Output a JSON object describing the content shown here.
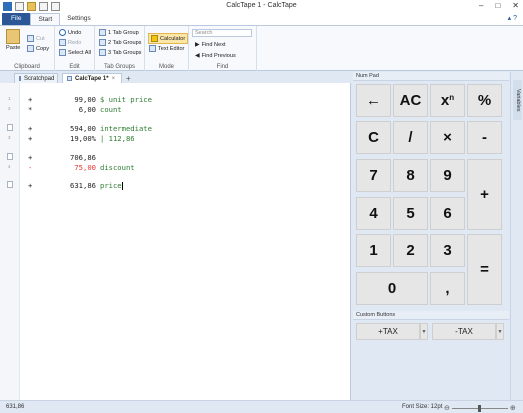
{
  "window": {
    "title": "CalcTape 1 - CalcTape"
  },
  "ribbon": {
    "tabs": [
      "File",
      "Start",
      "Settings"
    ],
    "groups": {
      "clipboard": {
        "label": "Clipboard",
        "paste": "Paste",
        "cut": "Cut",
        "copy": "Copy"
      },
      "edit": {
        "label": "Edit",
        "undo": "Undo",
        "redo": "Redo",
        "select_all": "Select All"
      },
      "tab_groups": {
        "label": "Tab Groups",
        "g1": "1 Tab Group",
        "g2": "2 Tab Groups",
        "g3": "3 Tab Groups"
      },
      "mode": {
        "label": "Mode",
        "calculator": "Calculator",
        "text_editor": "Text Editor"
      },
      "find": {
        "label": "Find",
        "search_placeholder": "Search",
        "find_next": "Find Next",
        "find_previous": "Find Previous"
      }
    }
  },
  "doc_tabs": [
    {
      "label": "Scratchpad"
    },
    {
      "label": "CalcTape 1*"
    }
  ],
  "tape": [
    {
      "ln": "1",
      "op": "+",
      "value": "99,00",
      "comment": "$ unit price"
    },
    {
      "ln": "2",
      "op": "*",
      "value": "6,00",
      "comment": "count"
    },
    {
      "ln": "",
      "op": "+",
      "value": "594,00",
      "comment": "intermediate"
    },
    {
      "ln": "3",
      "op": "+",
      "value": "19,00%",
      "comment": "| 112,86"
    },
    {
      "ln": "",
      "op": "+",
      "value": "706,86",
      "comment": ""
    },
    {
      "ln": "4",
      "op": "-",
      "value": "75,00",
      "comment": "discount"
    },
    {
      "ln": "",
      "op": "+",
      "value": "631,86",
      "comment": "price"
    }
  ],
  "numpad": {
    "title": "Num Pad",
    "keys": {
      "back": "←",
      "ac": "AC",
      "pow": "x",
      "pow_sup": "n",
      "percent": "%",
      "c": "C",
      "div": "/",
      "mul": "×",
      "minus": "-",
      "k7": "7",
      "k8": "8",
      "k9": "9",
      "plus": "+",
      "k4": "4",
      "k5": "5",
      "k6": "6",
      "k1": "1",
      "k2": "2",
      "k3": "3",
      "equals": "=",
      "k0": "0",
      "comma": ","
    }
  },
  "custom_buttons": {
    "title": "Custom Buttons",
    "plus_tax": "+TAX",
    "minus_tax": "-TAX"
  },
  "side_strip": {
    "label": "Variables"
  },
  "status": {
    "result": "631,86",
    "font_size": "Font Size: 12pt"
  }
}
